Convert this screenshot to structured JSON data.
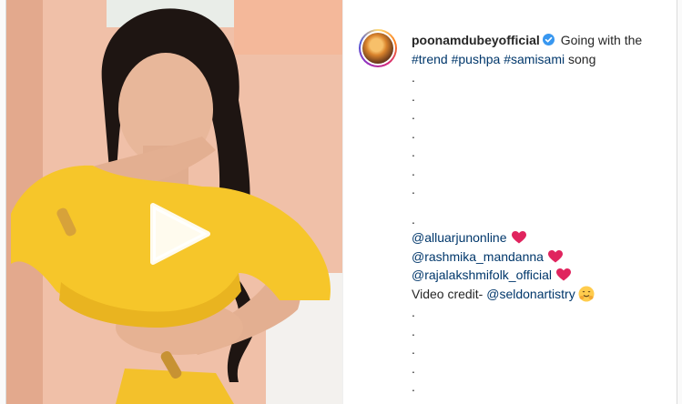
{
  "post": {
    "username": "poonamdubeyofficial",
    "verified": true,
    "caption_text": "Going with the",
    "hashtags": [
      "#trend",
      "#pushpa",
      "#samisami"
    ],
    "hashtag_suffix": "song",
    "dots_top": [
      ".",
      ".",
      ".",
      ".",
      ".",
      ".",
      ".",
      "."
    ],
    "dot_before_mentions": ".",
    "mentions": [
      {
        "handle": "@alluarjunonline",
        "emoji": "red-heart-icon"
      },
      {
        "handle": "@rashmika_mandanna",
        "emoji": "red-heart-icon"
      },
      {
        "handle": "@rajalakshmifolk_official",
        "emoji": "red-heart-icon"
      }
    ],
    "credit_label": "Video credit-",
    "credit_handle": "@seldonartistry",
    "credit_emoji": "hugging-face-icon",
    "dots_bottom": [
      ".",
      ".",
      ".",
      ".",
      "."
    ]
  },
  "media": {
    "type": "video",
    "play_icon": "play-icon"
  },
  "colors": {
    "link": "#00376b",
    "text": "#262626",
    "verified": "#3897f0",
    "heart": "#e0245e"
  }
}
